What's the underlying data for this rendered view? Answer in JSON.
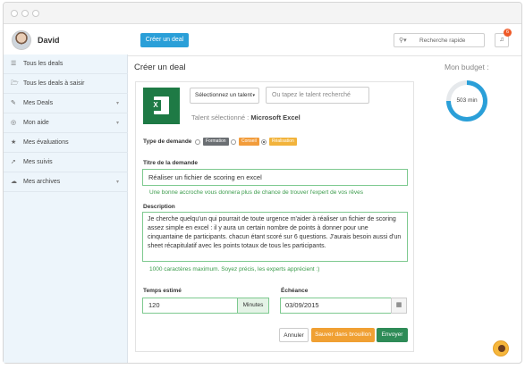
{
  "header": {
    "user_name": "David",
    "create_button": "Créer un deal",
    "search_placeholder": "Recherche rapide",
    "notification_count": "6"
  },
  "sidebar": {
    "items": [
      {
        "icon": "list-icon",
        "label": "Tous les deals",
        "chevron": false
      },
      {
        "icon": "folder-open-icon",
        "label": "Tous les deals à saisir",
        "chevron": false
      },
      {
        "icon": "edit-icon",
        "label": "Mes Deals",
        "chevron": true
      },
      {
        "icon": "life-ring-icon",
        "label": "Mon aide",
        "chevron": true
      },
      {
        "icon": "star-icon",
        "label": "Mes évaluations",
        "chevron": false
      },
      {
        "icon": "pin-icon",
        "label": "Mes suivis",
        "chevron": false
      },
      {
        "icon": "cloud-icon",
        "label": "Mes archives",
        "chevron": true
      }
    ]
  },
  "main": {
    "title": "Créer un deal",
    "talent_select": "Sélectionnez un talent",
    "talent_input_placeholder": "Ou tapez le talent recherché",
    "talent_selected_prefix": "Talent sélectionné :",
    "talent_selected_value": "Microsoft Excel",
    "demand_type_label": "Type de demande",
    "demand_types": [
      {
        "label": "Formation",
        "color": "#6b6f73",
        "checked": false
      },
      {
        "label": "Conseil",
        "color": "#f29c3b",
        "checked": false
      },
      {
        "label": "Réalisation",
        "color": "#f2b33b",
        "checked": true
      }
    ],
    "title_label": "Titre de la demande",
    "title_value": "Réaliser un fichier de scoring en excel",
    "title_help": "Une bonne accroche vous donnera plus de chance de trouver l'expert de vos rêves",
    "description_label": "Description",
    "description_value": "Je cherche quelqu'un qui pourrait de toute urgence m'aider à réaliser un fichier de scoring assez simple en excel : il y  aura un certain nombre de points à donner pour une cinquantaine de participants. chacun étant scoré sur 6 questions. J'aurais besoin aussi d'un sheet récapitulatif avec les points totaux de tous les participants.",
    "description_help": "1000 caractères maximum. Soyez précis, les experts apprécient :)",
    "time_label": "Temps estimé",
    "time_value": "120",
    "time_unit": "Minutes",
    "deadline_label": "Échéance",
    "deadline_value": "03/09/2015",
    "buttons": {
      "cancel": "Annuler",
      "save_draft": "Sauver dans brouillon",
      "send": "Envoyer"
    }
  },
  "budget": {
    "label": "Mon budget :",
    "value": "503 min",
    "fill_fraction": 0.75
  },
  "colors": {
    "accent": "#2a9fd8",
    "success": "#2e8b57",
    "warning": "#f0a033",
    "excel": "#1e7a45"
  }
}
